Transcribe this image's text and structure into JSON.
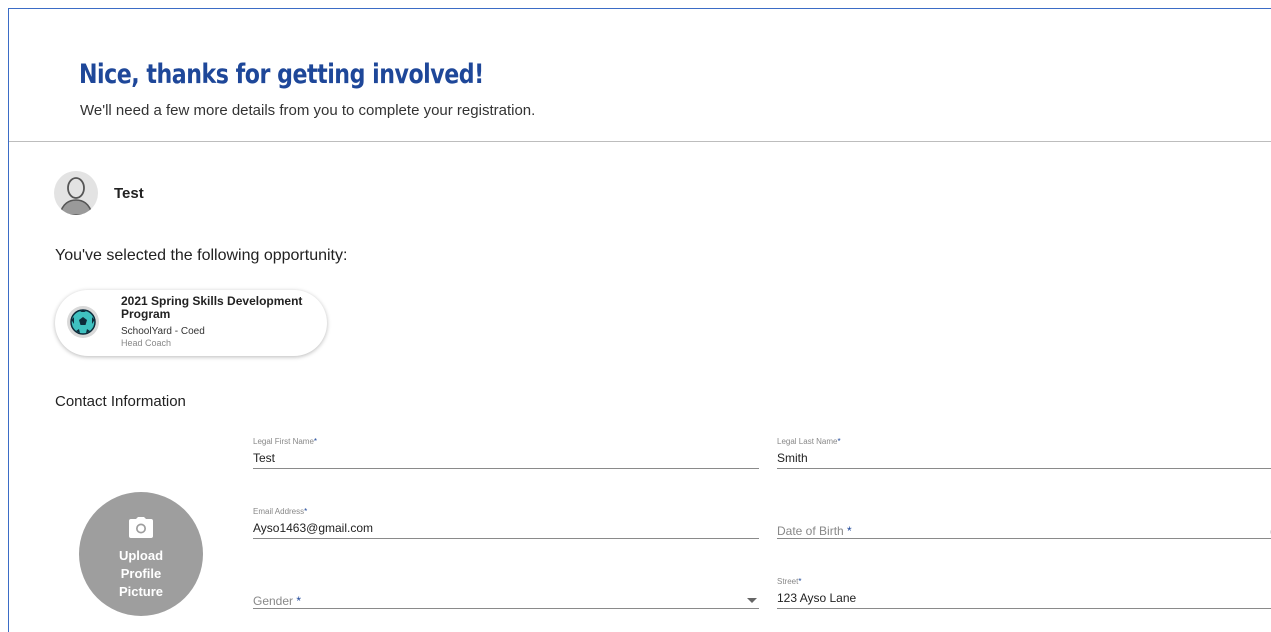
{
  "header": {
    "title": "Nice, thanks for getting involved!",
    "subtitle": "We'll need a few more details from you to complete your registration."
  },
  "user": {
    "name": "Test",
    "avatar_icon": "user-silhouette-icon"
  },
  "opportunity": {
    "heading": "You've selected the following opportunity:",
    "card": {
      "icon": "soccer-ball-icon",
      "title": "2021 Spring Skills Development Program",
      "subtitle": "SchoolYard - Coed",
      "role": "Head Coach"
    }
  },
  "contact": {
    "heading": "Contact Information",
    "upload": {
      "icon": "camera-icon",
      "label": "Upload\nProfile\nPicture"
    },
    "fields": {
      "first_name": {
        "label": "Legal First Name",
        "required": "*",
        "value": "Test"
      },
      "last_name": {
        "label": "Legal Last Name",
        "required": "*",
        "value": "Smith"
      },
      "email": {
        "label": "Email Address",
        "required": "*",
        "value": "Ayso1463@gmail.com"
      },
      "dob": {
        "placeholder": "Date of Birth",
        "required": "*",
        "trailing": "("
      },
      "gender": {
        "placeholder": "Gender",
        "required": "*"
      },
      "street": {
        "label": "Street",
        "required": "*",
        "value": "123 Ayso Lane"
      }
    }
  },
  "colors": {
    "title": "#1e4799",
    "frame_border": "#3b6cc6",
    "upload_bg": "#9e9e9e"
  }
}
